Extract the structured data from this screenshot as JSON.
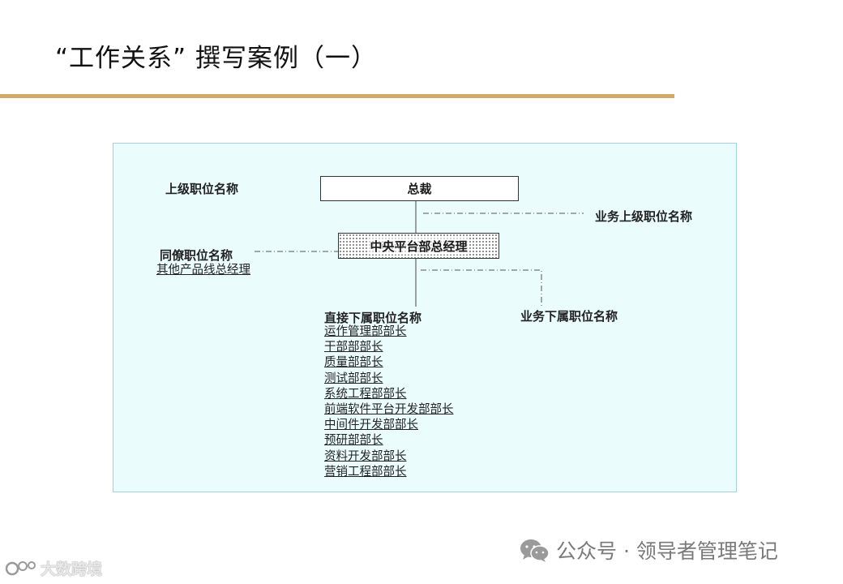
{
  "title": "“工作关系” 撰写案例（一）",
  "diagram": {
    "superior_label": "上级职位名称",
    "superior_position": "总裁",
    "business_superior_label": "业务上级职位名称",
    "current_position": "中央平台部总经理",
    "peer_label": "同僚职位名称",
    "peer_position": "其他产品线总经理",
    "direct_subordinates_label": "直接下属职位名称",
    "business_subordinates_label": "业务下属职位名称",
    "direct_subordinates": [
      "运作管理部部长",
      "干部部部长",
      "质量部部长",
      "测试部部长",
      "系统工程部部长",
      "前端软件平台开发部部长",
      "中间件开发部部长",
      "预研部部长",
      "资料开发部部长",
      "营销工程部部长"
    ]
  },
  "footer": {
    "brand": "公众号 · 领导者管理笔记",
    "brand_icon": "wechat-icon"
  },
  "watermark": {
    "text": "大数跨境",
    "icon": "logo-icon"
  },
  "colors": {
    "title_rule": "#d2a96a",
    "panel_background": "#ebfcfd",
    "panel_border": "#a8cfe0"
  }
}
